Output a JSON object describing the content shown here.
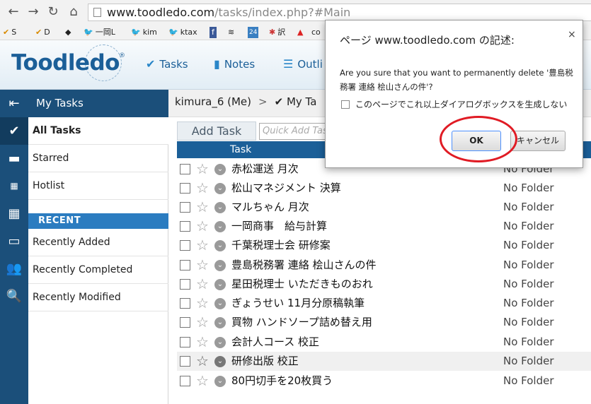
{
  "browser": {
    "url_host": "www.toodledo.com",
    "url_path": "/tasks/index.php?#Main",
    "bookmarks": [
      "S",
      "D",
      "",
      "一岡L",
      "kim",
      "ktax",
      "",
      "",
      "24",
      "訳",
      "",
      "co"
    ]
  },
  "app": {
    "logo": "Toodledo",
    "logo_reg": "®",
    "nav": [
      "Tasks",
      "Notes",
      "Outli"
    ]
  },
  "sidebar": {
    "header": "My Tasks",
    "items": [
      "All Tasks",
      "Starred",
      "Hotlist"
    ],
    "recent_header": "RECENT",
    "recent_items": [
      "Recently Added",
      "Recently Completed",
      "Recently Modified"
    ]
  },
  "breadcrumb": {
    "user": "kimura_6 (Me)",
    "sep": ">",
    "current": "✔ My Ta"
  },
  "toolbar": {
    "add_task": "Add Task",
    "quick_add_placeholder": "Quick Add Tas"
  },
  "table": {
    "col_task": "Task",
    "rows": [
      {
        "name": "赤松運送 月次",
        "folder": "No Folder"
      },
      {
        "name": "松山マネジメント 決算",
        "folder": "No Folder"
      },
      {
        "name": "マルちゃん 月次",
        "folder": "No Folder"
      },
      {
        "name": "一岡商事　給与計算",
        "folder": "No Folder"
      },
      {
        "name": "千葉税理士会 研修案",
        "folder": "No Folder"
      },
      {
        "name": "豊島税務署 連絡 桧山さんの件",
        "folder": "No Folder"
      },
      {
        "name": "星田税理士 いただきものおれ",
        "folder": "No Folder"
      },
      {
        "name": "ぎょうせい 11月分原稿執筆",
        "folder": "No Folder"
      },
      {
        "name": "買物 ハンドソープ詰め替え用",
        "folder": "No Folder"
      },
      {
        "name": "会計人コース 校正",
        "folder": "No Folder"
      },
      {
        "name": "研修出版 校正",
        "folder": "No Folder"
      },
      {
        "name": "80円切手を20枚買う",
        "folder": "No Folder"
      }
    ]
  },
  "dialog": {
    "title": "ページ www.toodledo.com の記述:",
    "close": "×",
    "message": "Are you sure that you want to permanently delete '豊島税務署 連絡 桧山さんの件'?",
    "checkbox_label": "このページでこれ以上ダイアログボックスを生成しない",
    "ok": "OK",
    "cancel": "キャンセル"
  },
  "colors": {
    "brand": "#1b5f98",
    "sidebar_dark": "#1b4f7a",
    "recent_header": "#2b7cc0",
    "highlight": "#e01b24"
  }
}
